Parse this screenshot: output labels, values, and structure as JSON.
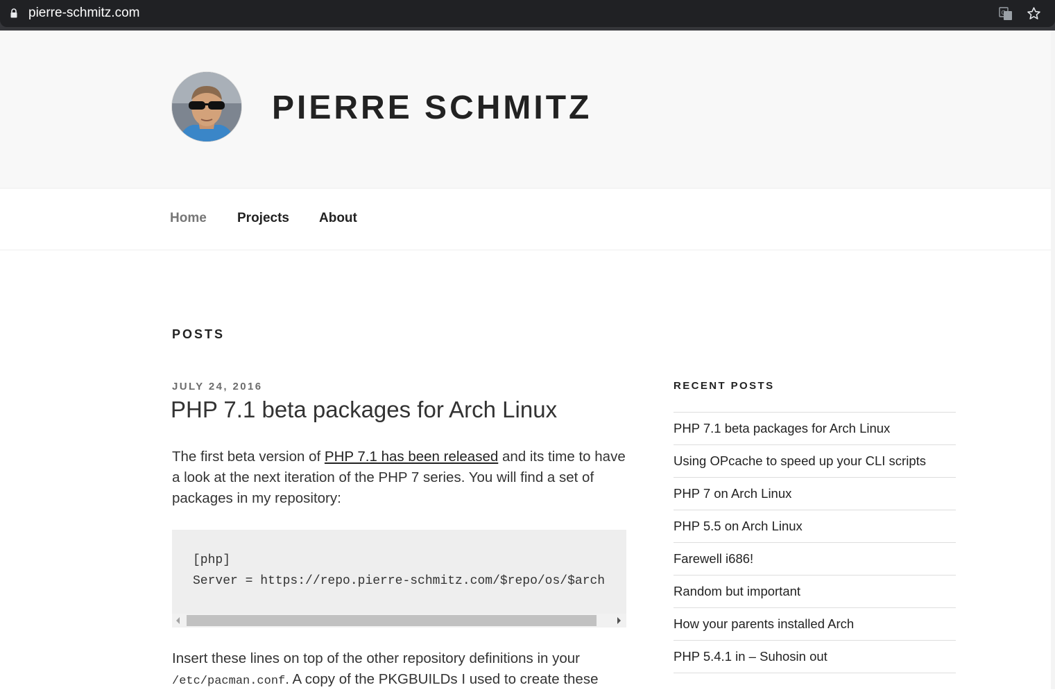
{
  "browser": {
    "url": "pierre-schmitz.com",
    "icons": [
      "lock-icon",
      "translate-icon",
      "star-icon"
    ]
  },
  "header": {
    "site_title": "PIERRE SCHMITZ"
  },
  "nav": {
    "items": [
      {
        "label": "Home",
        "current": true
      },
      {
        "label": "Projects",
        "current": false
      },
      {
        "label": "About",
        "current": false
      }
    ]
  },
  "main": {
    "heading": "POSTS",
    "post": {
      "date": "JULY 24, 2016",
      "title": "PHP 7.1 beta packages for Arch Linux",
      "p1_before": "The first beta version of ",
      "p1_link": "PHP 7.1 has been released",
      "p1_after": " and its time to have a look at the next iteration of the PHP 7 series. You will find a set of packages in my repository:",
      "code": [
        "[php]",
        "Server = https://repo.pierre-schmitz.com/$repo/os/$arch"
      ],
      "p2_before": "Insert these lines on top of the other repository definitions in your ",
      "p2_code": "/etc/pacman.conf",
      "p2_after": ". A copy of the PKGBUILDs I used to create these"
    }
  },
  "sidebar": {
    "widget_title": "RECENT POSTS",
    "recent_posts": [
      "PHP 7.1 beta packages for Arch Linux",
      "Using OPcache to speed up your CLI scripts",
      "PHP 7 on Arch Linux",
      "PHP 5.5 on Arch Linux",
      "Farewell i686!",
      "Random but important",
      "How your parents installed Arch",
      "PHP 5.4.1 in – Suhosin out"
    ]
  },
  "colors": {
    "header_bg": "#f8f8f8",
    "text": "#222222",
    "nav_current": "#767676",
    "code_bg": "#eeeeee"
  }
}
